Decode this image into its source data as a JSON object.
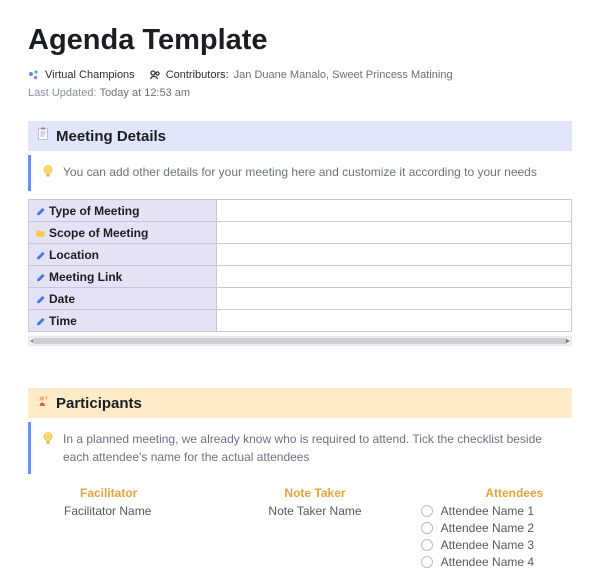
{
  "title": "Agenda Template",
  "workspace": "Virtual Champions",
  "contributors_label": "Contributors:",
  "contributors_names": "Jan Duane Manalo, Sweet Princess Matining",
  "last_updated_label": "Last Updated:",
  "last_updated_value": "Today at 12:53 am",
  "sections": {
    "meeting": {
      "header": "Meeting Details",
      "callout": "You can add other details for your meeting here and customize it according to your needs",
      "rows": [
        {
          "icon": "pen",
          "label": "Type of Meeting",
          "value": ""
        },
        {
          "icon": "folder",
          "label": "Scope of Meeting",
          "value": ""
        },
        {
          "icon": "pen",
          "label": "Location",
          "value": ""
        },
        {
          "icon": "pen",
          "label": "Meeting Link",
          "value": ""
        },
        {
          "icon": "pen",
          "label": "Date",
          "value": ""
        },
        {
          "icon": "pen",
          "label": "Time",
          "value": ""
        }
      ]
    },
    "participants": {
      "header": "Participants",
      "callout": "In a planned meeting, we already know who is required to attend. Tick the checklist beside each attendee's name for the actual attendees",
      "columns": {
        "facilitator": {
          "head": "Facilitator",
          "value": "Facilitator Name"
        },
        "note_taker": {
          "head": "Note Taker",
          "value": "Note Taker Name"
        },
        "attendees": {
          "head": "Attendees",
          "items": [
            "Attendee Name 1",
            "Attendee Name 2",
            "Attendee Name 3",
            "Attendee Name 4"
          ]
        }
      }
    }
  }
}
